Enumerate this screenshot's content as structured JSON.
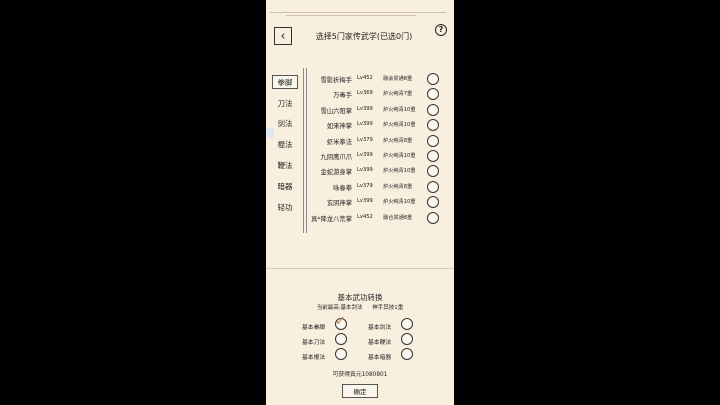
{
  "header": {
    "title": "选择5门家传武学(已选0门)",
    "back_icon": "back-arrow-icon",
    "help_label": "?"
  },
  "tabs": [
    "拳脚",
    "刀法",
    "剑法",
    "棍法",
    "鞭法",
    "暗器",
    "轻功"
  ],
  "active_tab": 0,
  "skills": [
    {
      "name": "雪影折梅手",
      "level": "Lv452",
      "status": "融会贯通8重"
    },
    {
      "name": "万毒手",
      "level": "Lv369",
      "status": "炉火纯青7重"
    },
    {
      "name": "雪山六阳掌",
      "level": "Lv399",
      "status": "炉火纯青10重"
    },
    {
      "name": "如来神掌",
      "level": "Lv399",
      "status": "炉火纯青10重"
    },
    {
      "name": "虾米拳法",
      "level": "Lv379",
      "status": "炉火纯青8重"
    },
    {
      "name": "九阴鹰爪爪",
      "level": "Lv399",
      "status": "炉火纯青10重"
    },
    {
      "name": "金蛇游身掌",
      "level": "Lv399",
      "status": "炉火纯青10重"
    },
    {
      "name": "咏春拳",
      "level": "Lv379",
      "status": "炉火纯青8重"
    },
    {
      "name": "玄阴神掌",
      "level": "Lv399",
      "status": "炉火纯青10重"
    },
    {
      "name": "真*降龙八荒掌",
      "level": "Lv452",
      "status": "融合贯通8重"
    }
  ],
  "conversion": {
    "title": "基本武功转换",
    "current_best": "当前最高:基本剑法",
    "skill_level": "神手其技1重",
    "options": [
      {
        "label": "基本拳脚",
        "checked": true
      },
      {
        "label": "基本剑法",
        "checked": false
      },
      {
        "label": "基本刀法",
        "checked": false
      },
      {
        "label": "基本鞭法",
        "checked": false
      },
      {
        "label": "基本棍法",
        "checked": false
      },
      {
        "label": "基本暗器",
        "checked": false
      }
    ],
    "reward": "可获得真元1080801",
    "confirm_label": "确定"
  },
  "colors": {
    "background": "#f8efde",
    "check": "#c98a1a"
  }
}
